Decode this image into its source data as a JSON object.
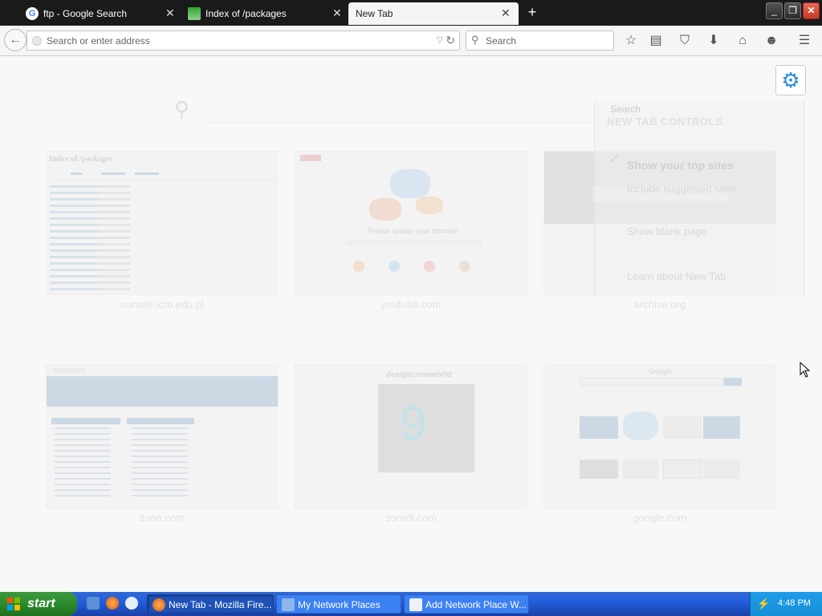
{
  "tabs": [
    {
      "title": "ftp - Google Search",
      "icon": "google-icon"
    },
    {
      "title": "Index of /packages",
      "icon": "image-icon"
    },
    {
      "title": "New Tab",
      "icon": "none",
      "active": true
    }
  ],
  "window": {
    "minimize": "_",
    "restore": "❐",
    "close": "✕"
  },
  "nav": {
    "url_placeholder": "Search or enter address",
    "search_placeholder": "Search"
  },
  "newtab": {
    "controls": {
      "search_label": "Search",
      "heading": "NEW TAB CONTROLS",
      "show_top_sites": "Show your top sites",
      "show_suggested": "Include suggested sites",
      "show_blank": "Show blank page",
      "learn_more": "Learn about New Tab"
    },
    "tiles": [
      {
        "caption": "sunsite.icm.edu.pl",
        "thumb_title": "Index of /packages"
      },
      {
        "caption": "youtube.com",
        "thumb_title": "Please update your browser"
      },
      {
        "caption": "archive.org",
        "thumb_title": ""
      },
      {
        "caption": "zone.com",
        "thumb_title": ""
      },
      {
        "caption": "zone9.com",
        "thumb_title": "designzoneworld"
      },
      {
        "caption": "google.com",
        "thumb_title": "Google"
      }
    ]
  },
  "taskbar": {
    "start_label": "start",
    "tasks": [
      {
        "label": "New Tab - Mozilla Fire...",
        "active": true
      },
      {
        "label": "My Network Places",
        "active": false
      },
      {
        "label": "Add Network Place W...",
        "active": false
      }
    ],
    "clock": "4:48 PM"
  },
  "colors": {
    "accent": "#2a8ae2",
    "taskbar": "#245edc",
    "start": "#2b8a2b"
  }
}
